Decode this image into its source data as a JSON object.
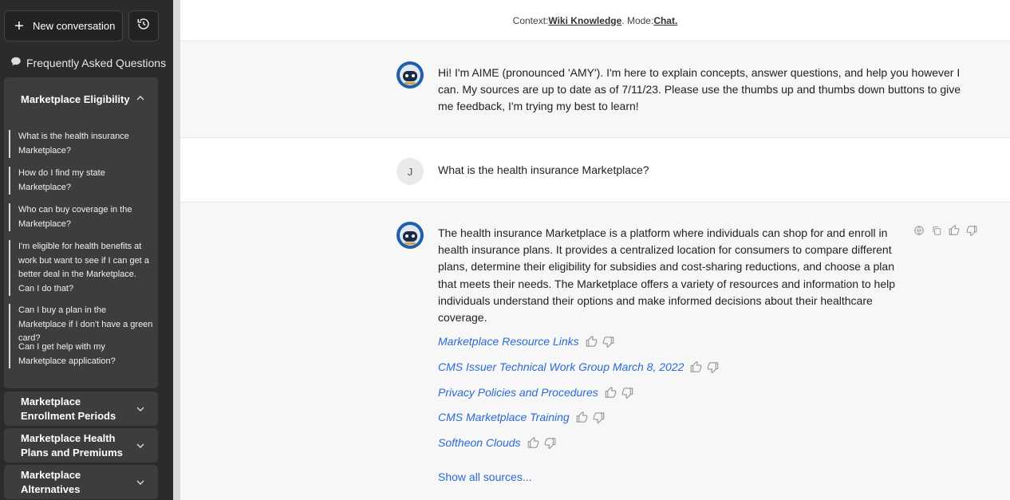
{
  "sidebar": {
    "new_conversation": "New conversation",
    "faq_heading": "Frequently Asked Questions",
    "open_section": {
      "title": "Marketplace Eligibility",
      "questions": [
        "What is the health insurance Marketplace?",
        "How do I find my state Marketplace?",
        "Who can buy coverage in the Marketplace?",
        "I'm eligible for health benefits at work but want to see if I can get a better deal in the Marketplace. Can I do that?",
        "Can I buy a plan in the Marketplace if I don't have a green card?",
        "Can I get help with my Marketplace application?"
      ]
    },
    "closed_sections": [
      "Marketplace Enrollment Periods",
      "Marketplace Health Plans and Premiums",
      "Marketplace Alternatives"
    ]
  },
  "context": {
    "prefix": "Context: ",
    "context_value": "Wiki Knowledge",
    "mode_prefix": ". Mode: ",
    "mode_value": "Chat."
  },
  "messages": {
    "bot_intro": "Hi! I'm AIME (pronounced 'AMY'). I'm here to explain concepts, answer questions, and help you however I can. My sources are up to date as of 7/11/23. Please use the thumbs up and thumbs down buttons to give me feedback, I'm trying my best to learn!",
    "user_initial": "J",
    "user_question": "What is the health insurance Marketplace?",
    "bot_answer": "The health insurance Marketplace is a platform where individuals can shop for and enroll in health insurance plans. It provides a centralized location for consumers to compare different plans, determine their eligibility for subsidies and cost-sharing reductions, and choose a plan that meets their needs. The Marketplace offers a variety of resources and information to help individuals understand their options and make informed decisions about their healthcare coverage.",
    "sources": [
      "Marketplace Resource Links",
      "CMS Issuer Technical Work Group March 8, 2022",
      "Privacy Policies and Procedures",
      "CMS Marketplace Training",
      "Softheon Clouds"
    ],
    "show_all": "Show all sources..."
  },
  "colors": {
    "sidebar_bg": "#2b2b2b",
    "panel_bg": "#3d3d3d",
    "link": "#2a6ad6",
    "avatar_blue": "#1f5fae"
  }
}
